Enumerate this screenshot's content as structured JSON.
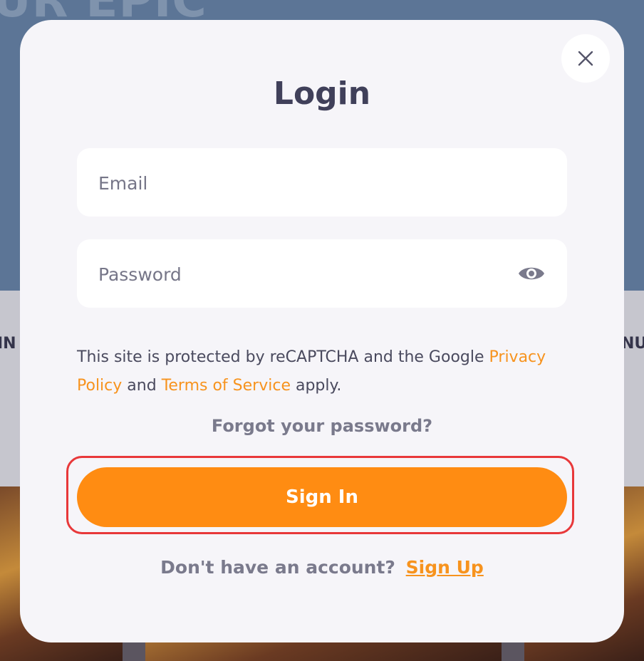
{
  "background": {
    "hero_text": "UR EPIC",
    "side_left_text": "IN",
    "side_right_text": "NU"
  },
  "modal": {
    "title": "Login",
    "close_icon": "close-icon",
    "email": {
      "placeholder": "Email",
      "value": ""
    },
    "password": {
      "placeholder": "Password",
      "value": "",
      "toggle_icon": "eye-icon"
    },
    "notice": {
      "prefix": "This site is protected by reCAPTCHA and the Google ",
      "privacy_link": "Privacy Policy",
      "middle": " and ",
      "terms_link": "Terms of Service",
      "suffix": " apply."
    },
    "forgot_password": "Forgot your password?",
    "signin_button": "Sign In",
    "signup_prompt": "Don't have an account?",
    "signup_link": "Sign Up"
  },
  "colors": {
    "accent": "#ff8c12",
    "link": "#f7931e",
    "highlight": "#e8383a",
    "title": "#40405a",
    "modal_bg": "#f6f5f9"
  }
}
